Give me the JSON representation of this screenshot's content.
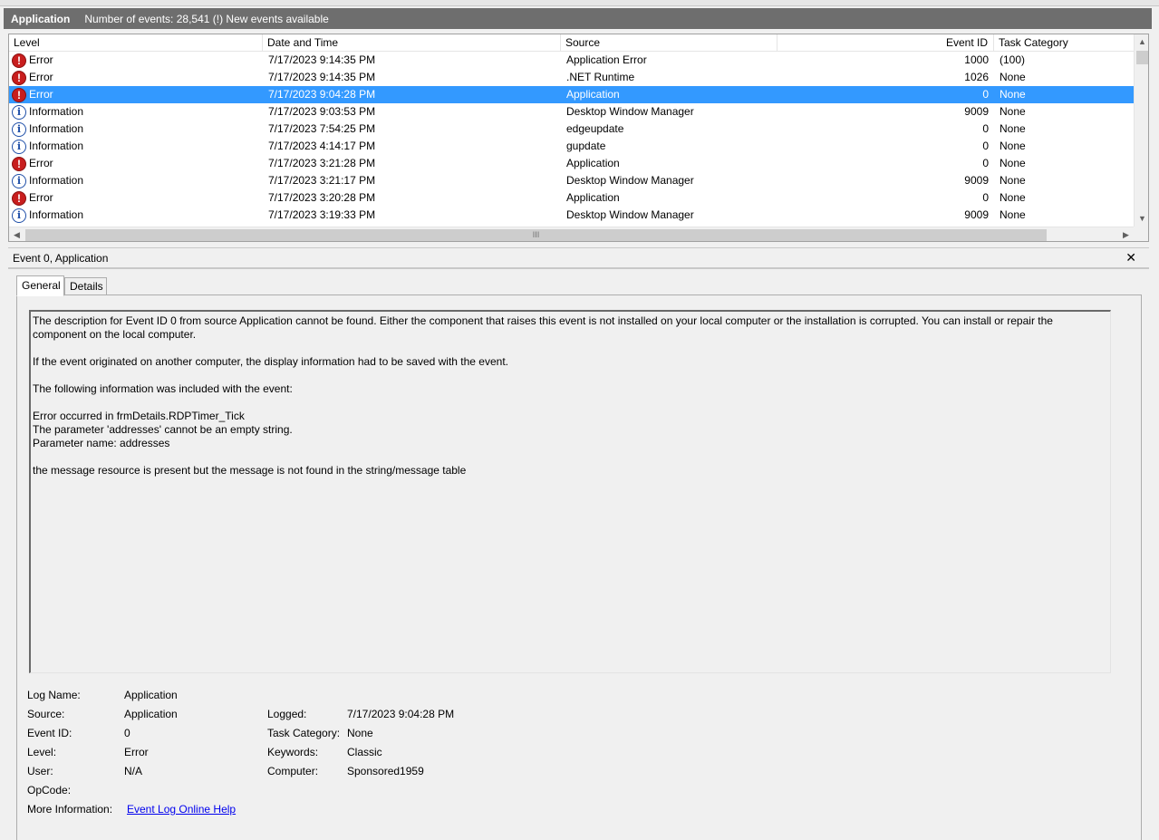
{
  "header": {
    "title": "Application",
    "count": "Number of events: 28,541 (!) New events available"
  },
  "columns": [
    "Level",
    "Date and Time",
    "Source",
    "Event ID",
    "Task Category"
  ],
  "rows": [
    {
      "icon": "error",
      "level": "Error",
      "datetime": "7/17/2023 9:14:35 PM",
      "source": "Application Error",
      "event_id": "1000",
      "category": "(100)",
      "selected": false
    },
    {
      "icon": "error",
      "level": "Error",
      "datetime": "7/17/2023 9:14:35 PM",
      "source": ".NET Runtime",
      "event_id": "1026",
      "category": "None",
      "selected": false
    },
    {
      "icon": "error",
      "level": "Error",
      "datetime": "7/17/2023 9:04:28 PM",
      "source": "Application",
      "event_id": "0",
      "category": "None",
      "selected": true
    },
    {
      "icon": "information",
      "level": "Information",
      "datetime": "7/17/2023 9:03:53 PM",
      "source": "Desktop Window Manager",
      "event_id": "9009",
      "category": "None",
      "selected": false
    },
    {
      "icon": "information",
      "level": "Information",
      "datetime": "7/17/2023 7:54:25 PM",
      "source": "edgeupdate",
      "event_id": "0",
      "category": "None",
      "selected": false
    },
    {
      "icon": "information",
      "level": "Information",
      "datetime": "7/17/2023 4:14:17 PM",
      "source": "gupdate",
      "event_id": "0",
      "category": "None",
      "selected": false
    },
    {
      "icon": "error",
      "level": "Error",
      "datetime": "7/17/2023 3:21:28 PM",
      "source": "Application",
      "event_id": "0",
      "category": "None",
      "selected": false
    },
    {
      "icon": "information",
      "level": "Information",
      "datetime": "7/17/2023 3:21:17 PM",
      "source": "Desktop Window Manager",
      "event_id": "9009",
      "category": "None",
      "selected": false
    },
    {
      "icon": "error",
      "level": "Error",
      "datetime": "7/17/2023 3:20:28 PM",
      "source": "Application",
      "event_id": "0",
      "category": "None",
      "selected": false
    },
    {
      "icon": "information",
      "level": "Information",
      "datetime": "7/17/2023 3:19:33 PM",
      "source": "Desktop Window Manager",
      "event_id": "9009",
      "category": "None",
      "selected": false
    }
  ],
  "icons": {
    "error_glyph": "!",
    "info_glyph": "i",
    "close_glyph": "✕",
    "scroll_up": "▲",
    "scroll_down": "▼",
    "scroll_left": "◀",
    "scroll_right": "▶",
    "thumb_grip": "III"
  },
  "detail": {
    "title": "Event 0, Application",
    "tabs": [
      "General",
      "Details"
    ],
    "description": [
      "The description for Event ID 0 from source Application cannot be found. Either the component that raises this event is not installed on your local computer or the installation is corrupted. You can install or repair the component on the local computer.",
      "If the event originated on another computer, the display information had to be saved with the event.",
      "The following information was included with the event:",
      "Error occurred in frmDetails.RDPTimer_Tick\nThe parameter 'addresses' cannot be an empty string.\nParameter name: addresses\n",
      "the message resource is present but the message is not found in the string/message table"
    ],
    "fields": {
      "log_name_label": "Log Name:",
      "log_name": "Application",
      "source_label": "Source:",
      "source": "Application",
      "logged_label": "Logged:",
      "logged": "7/17/2023 9:04:28 PM",
      "event_id_label": "Event ID:",
      "event_id": "0",
      "task_category_label": "Task Category:",
      "task_category": "None",
      "level_label": "Level:",
      "level": "Error",
      "keywords_label": "Keywords:",
      "keywords": "Classic",
      "user_label": "User:",
      "user": "N/A",
      "computer_label": "Computer:",
      "computer": "Sponsored1959",
      "opcode_label": "OpCode:",
      "opcode": "",
      "more_info_label": "More Information:",
      "more_info_link": "Event Log Online Help"
    }
  }
}
